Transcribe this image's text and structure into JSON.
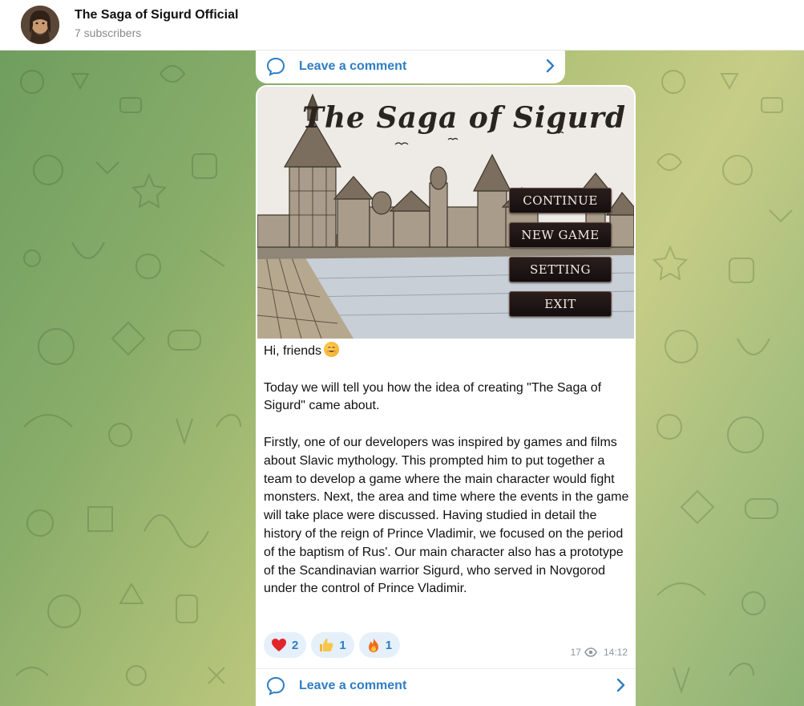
{
  "header": {
    "channel_name": "The Saga of Sigurd Official",
    "subscribers": "7 subscribers"
  },
  "top_post": {
    "comment_label": "Leave a comment"
  },
  "post": {
    "image": {
      "game_title": "The Saga of Sigurd",
      "menu": [
        "CONTINUE",
        "NEW GAME",
        "SETTING",
        "EXIT"
      ]
    },
    "paragraphs": [
      "Hi, friends",
      "Today we will tell you how the idea of creating \"The Saga of Sigurd\" came about.",
      "Firstly, one of our developers was inspired by games and films about Slavic mythology.  This prompted him to put together a team to develop a game where the main character would fight monsters.  Next, the area and time where the events in the game will take place were discussed.  Having studied in detail the history of the reign of Prince Vladimir, we focused on the period of the baptism of Rus'. Our main character also has a prototype of the Scandinavian warrior Sigurd, who served in Novgorod under the control of Prince Vladimir."
    ],
    "greeting_emoji": "smiling-face-icon",
    "reactions": [
      {
        "icon": "heart-icon",
        "count": "2"
      },
      {
        "icon": "thumbs-up-icon",
        "count": "1"
      },
      {
        "icon": "fire-icon",
        "count": "1"
      }
    ],
    "views": "17",
    "time": "14:12",
    "comment_label": "Leave a comment"
  },
  "colors": {
    "accent": "#2f7ec3",
    "reaction_bg": "#e5f0fa",
    "meta": "#8d969e",
    "wallpaper_start": "#6f9e5f",
    "wallpaper_mid": "#c7cd86"
  }
}
